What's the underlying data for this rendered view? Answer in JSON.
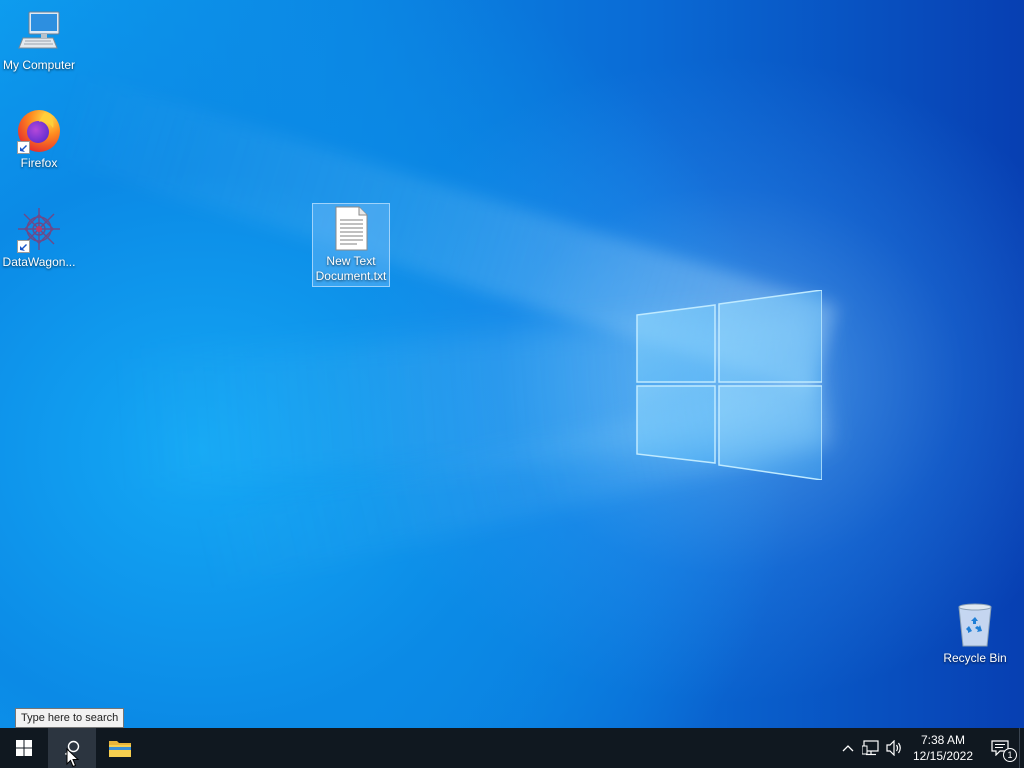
{
  "desktop": {
    "icons": [
      {
        "label": "My Computer",
        "icon": "computer-icon"
      },
      {
        "label": "Firefox",
        "icon": "firefox-icon",
        "shortcut": true
      },
      {
        "label": "DataWagon...",
        "icon": "datawagon-icon",
        "shortcut": true
      },
      {
        "label": "New Text Document.txt",
        "icon": "text-document-icon",
        "selected": true
      },
      {
        "label": "Recycle Bin",
        "icon": "recycle-bin-icon"
      }
    ]
  },
  "search_tooltip": "Type here to search",
  "taskbar": {
    "buttons": [
      {
        "name": "start",
        "icon": "windows-start-icon"
      },
      {
        "name": "search",
        "icon": "search-icon",
        "active": true
      },
      {
        "name": "file-explorer",
        "icon": "folder-icon"
      }
    ],
    "tray": {
      "icons": [
        "chevron-up-icon",
        "network-icon",
        "volume-icon"
      ],
      "time": "7:38 AM",
      "date": "12/15/2022",
      "notification_count": "1"
    }
  },
  "colors": {
    "taskbar_bg": "#101820",
    "wallpaper_light": "#14a8f5",
    "wallpaper_dark": "#073fb2",
    "selection": "#8cc8ff"
  }
}
